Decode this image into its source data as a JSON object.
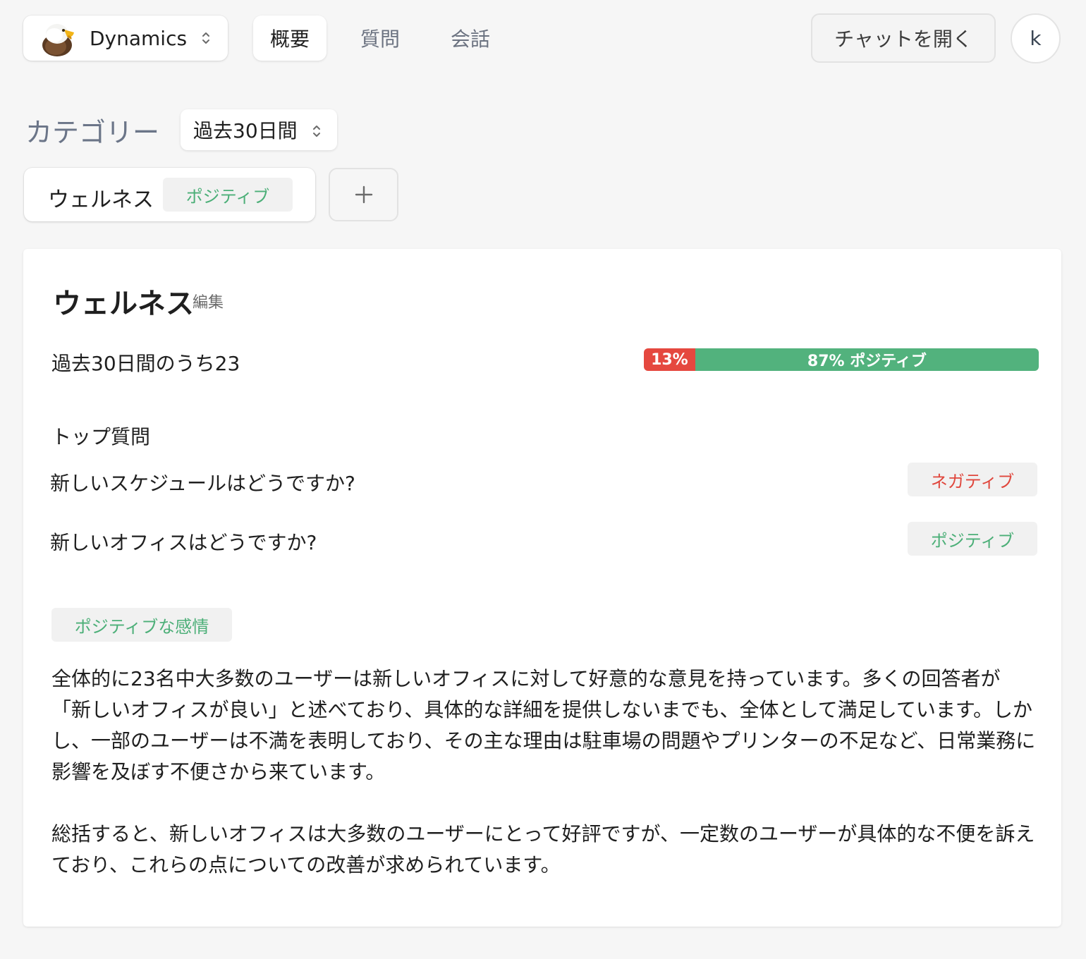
{
  "header": {
    "workspace": {
      "name": "Dynamics",
      "icon": "eagle-logo"
    },
    "tabs": [
      {
        "label": "概要",
        "active": true
      },
      {
        "label": "質問",
        "active": false
      },
      {
        "label": "会話",
        "active": false
      }
    ],
    "open_chat_label": "チャットを開く",
    "avatar_initial": "k"
  },
  "categories": {
    "title": "カテゴリー",
    "period_selected": "過去30日間",
    "chips": [
      {
        "label": "ウェルネス",
        "sentiment": "ポジティブ"
      }
    ],
    "add_label": "+"
  },
  "detail": {
    "title": "ウェルネス",
    "edit_label": "編集",
    "count_text": "過去30日間のうち23",
    "sentiment_bar": {
      "negative_percent": 13,
      "positive_percent": 87,
      "negative_label": "13%",
      "positive_label": "87% ポジティブ",
      "colors": {
        "negative": "#e5483f",
        "positive": "#52b27d"
      }
    },
    "top_questions_heading": "トップ質問",
    "top_questions": [
      {
        "question": "新しいスケジュールはどうですか?",
        "sentiment": "ネガティブ"
      },
      {
        "question": "新しいオフィスはどうですか?",
        "sentiment": "ポジティブ"
      }
    ],
    "sentiment_summary_label": "ポジティブな感情",
    "summary_paragraphs": [
      "全体的に23名中大多数のユーザーは新しいオフィスに対して好意的な意見を持っています。多くの回答者が「新しいオフィスが良い」と述べており、具体的な詳細を提供しないまでも、全体として満足しています。しかし、一部のユーザーは不満を表明しており、その主な理由は駐車場の問題やプリンターの不足など、日常業務に影響を及ぼす不便さから来ています。",
      "総括すると、新しいオフィスは大多数のユーザーにとって好評ですが、一定数のユーザーが具体的な不便を訴えており、これらの点についての改善が求められています。"
    ]
  }
}
